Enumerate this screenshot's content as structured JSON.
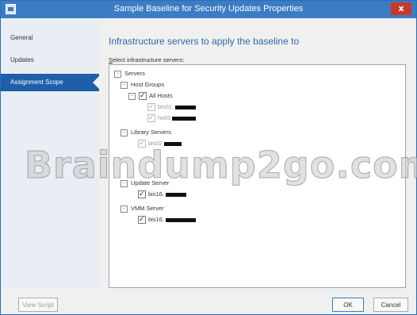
{
  "window": {
    "title": "Sample Baseline for Security Updates Properties",
    "close_glyph": "x"
  },
  "nav": {
    "items": [
      {
        "label": "General"
      },
      {
        "label": "Updates"
      },
      {
        "label": "Assignment Scope"
      }
    ],
    "selected": "Assignment Scope"
  },
  "main": {
    "title": "Infrastructure servers to apply the baseline to",
    "list_label_first": "S",
    "list_label_rest": "elect infrastructure servers:"
  },
  "tree": {
    "servers": "Servers",
    "host_groups": "Host Groups",
    "all_hosts": "All Hosts",
    "host1": "bis02.",
    "host2": "hv05",
    "library_servers": "Library Servers",
    "library1": "bis02",
    "update_server": "Update Server",
    "update1": "bis16.",
    "vmm_server": "VMM Server",
    "vmm1": "bis16."
  },
  "watermark": "Braindump2go.com",
  "footer": {
    "view_script": "View Script",
    "ok": "OK",
    "cancel": "Cancel"
  },
  "colors": {
    "title_bar": "#3b7cc4",
    "selected_nav": "#1f5ea8",
    "heading": "#2f68a8",
    "close_button": "#c7392b"
  }
}
